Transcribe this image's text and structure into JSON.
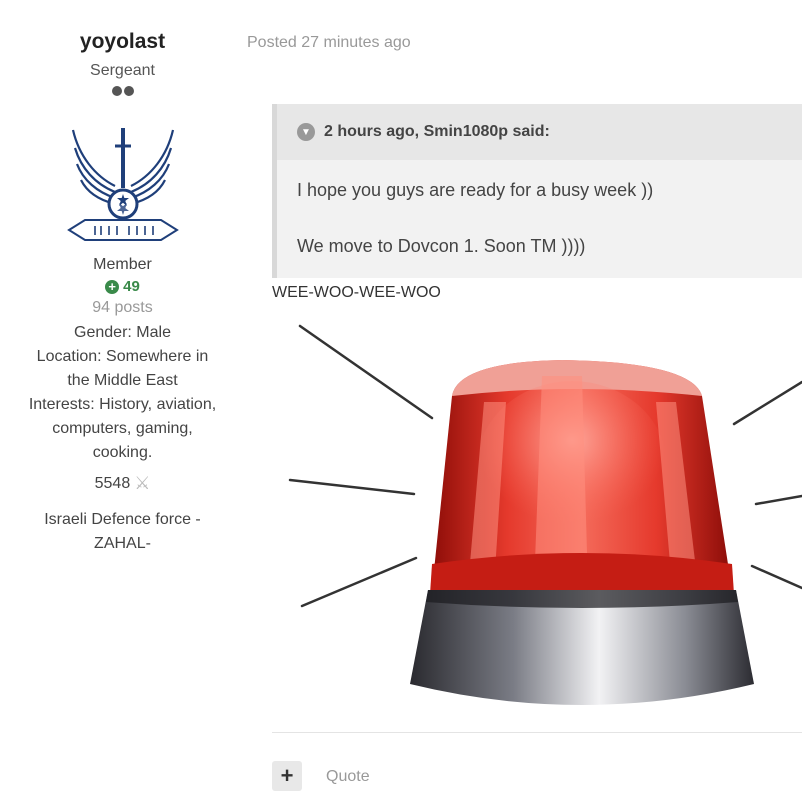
{
  "author": {
    "username": "yoyolast",
    "rank": "Sergeant",
    "group": "Member",
    "reputation": "49",
    "posts": "94 posts",
    "gender": "Gender: Male",
    "location_line1": "Location: Somewhere in",
    "location_line2": "the Middle East",
    "interests_line1": "Interests: History, aviation,",
    "interests_line2": "computers, gaming,",
    "interests_line3": "cooking.",
    "points": "5548",
    "unit_line1": "Israeli Defence force -",
    "unit_line2": "ZAHAL-"
  },
  "post": {
    "posted": "Posted 27 minutes ago",
    "quote": {
      "header": "2 hours ago, Smin1080p said:",
      "line1": "I hope you guys are ready for a busy week ))",
      "line2": "We move to Dovcon 1. Soon TM ))))"
    },
    "text": "WEE-WOO-WEE-WOO",
    "quote_button": "Quote"
  },
  "colors": {
    "reputation_green": "#3a8a4a",
    "siren_red": "#d0241c",
    "quote_bg": "#f2f2f2"
  },
  "icons": [
    "rank-pip-icon",
    "air-force-emblem",
    "reputation-plus-icon",
    "crossed-swords-icon",
    "chevron-down-icon",
    "siren-image",
    "plus-icon"
  ]
}
